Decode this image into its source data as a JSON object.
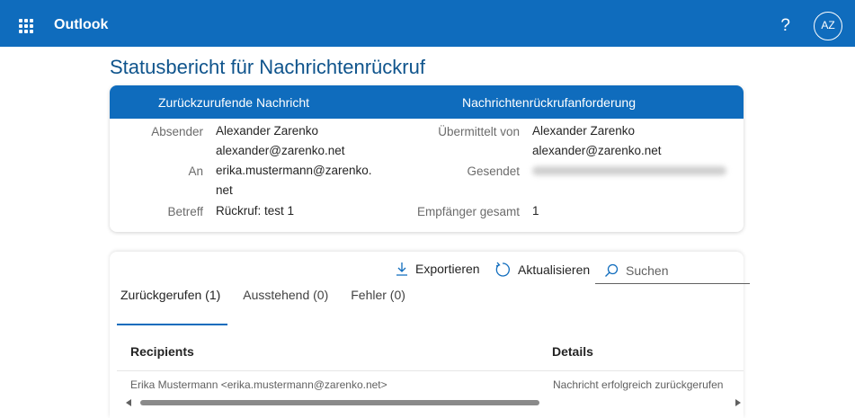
{
  "header": {
    "app_name": "Outlook",
    "help_label": "?",
    "avatar_initials": "AZ"
  },
  "page": {
    "title": "Statusbericht für Nachrichtenrückruf"
  },
  "card": {
    "col1_header": "Zurückzurufende Nachricht",
    "col2_header": "Nachrichtenrückrufanforderung",
    "sender_label": "Absender",
    "sender_name": "Alexander Zarenko",
    "sender_email": "alexander@zarenko.net",
    "to_label": "An",
    "to_line1": "erika.mustermann@zarenko.",
    "to_line2": "net",
    "subject_label": "Betreff",
    "subject_value": "Rückruf: test 1",
    "submitted_by_label": "Übermittelt von",
    "submitted_by_name": "Alexander Zarenko",
    "submitted_by_email": "alexander@zarenko.net",
    "sent_label": "Gesendet",
    "total_recipients_label": "Empfänger gesamt",
    "total_recipients_value": "1"
  },
  "toolbar": {
    "export_label": "Exportieren",
    "refresh_label": "Aktualisieren",
    "search_placeholder": "Suchen"
  },
  "tabs": [
    {
      "label": "Zurückgerufen (1)",
      "active": true
    },
    {
      "label": "Ausstehend (0)",
      "active": false
    },
    {
      "label": "Fehler (0)",
      "active": false
    }
  ],
  "table": {
    "headers": [
      "Recipients",
      "Details"
    ],
    "rows": [
      {
        "recipient": "Erika Mustermann <erika.mustermann@zarenko.net>",
        "details": "Nachricht erfolgreich zurückgerufen"
      }
    ]
  },
  "colors": {
    "brand": "#0f6cbd",
    "title": "#0f548c"
  }
}
